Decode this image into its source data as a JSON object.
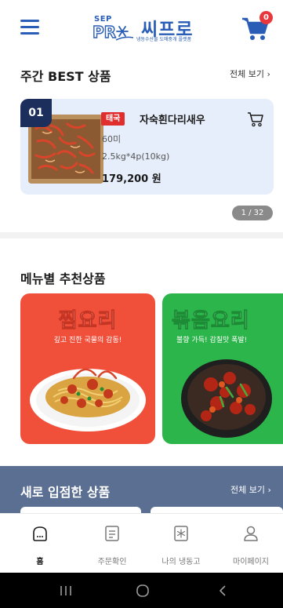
{
  "header": {
    "logo_sep": "SEP",
    "logo_name": "씨프로",
    "logo_sub": "냉동수산물 도매중개 플랫폼",
    "cart_count": "0",
    "brand_color": "#2a5db5"
  },
  "best": {
    "title": "주간 BEST 상품",
    "view_all": "전체 보기 ›",
    "item": {
      "rank": "01",
      "origin": "태국",
      "name": "자숙흰다리새우",
      "count": "60미",
      "spec": "2.5kg*4p(10kg)",
      "price": "179,200 원"
    },
    "pager": "1 / 32"
  },
  "menu_section": {
    "title": "메뉴별 추천상품",
    "cards": [
      {
        "title": "찜요리",
        "subtitle": "깊고 진한 국물의 감동!",
        "color": "#f04f3a"
      },
      {
        "title": "볶음요리",
        "subtitle": "불향 가득! 감칠맛 폭발!",
        "color": "#2bb54a"
      }
    ]
  },
  "new_section": {
    "title": "새로 입점한 상품",
    "view_all": "전체 보기 ›"
  },
  "tabs": [
    {
      "label": "홈",
      "icon": "home-icon",
      "active": true
    },
    {
      "label": "주문확인",
      "icon": "order-list-icon",
      "active": false
    },
    {
      "label": "나의 냉동고",
      "icon": "freezer-icon",
      "active": false
    },
    {
      "label": "마이페이지",
      "icon": "user-icon",
      "active": false
    }
  ],
  "system_nav": {
    "icons": [
      "recent-apps-icon",
      "home-circle-icon",
      "back-icon"
    ]
  }
}
